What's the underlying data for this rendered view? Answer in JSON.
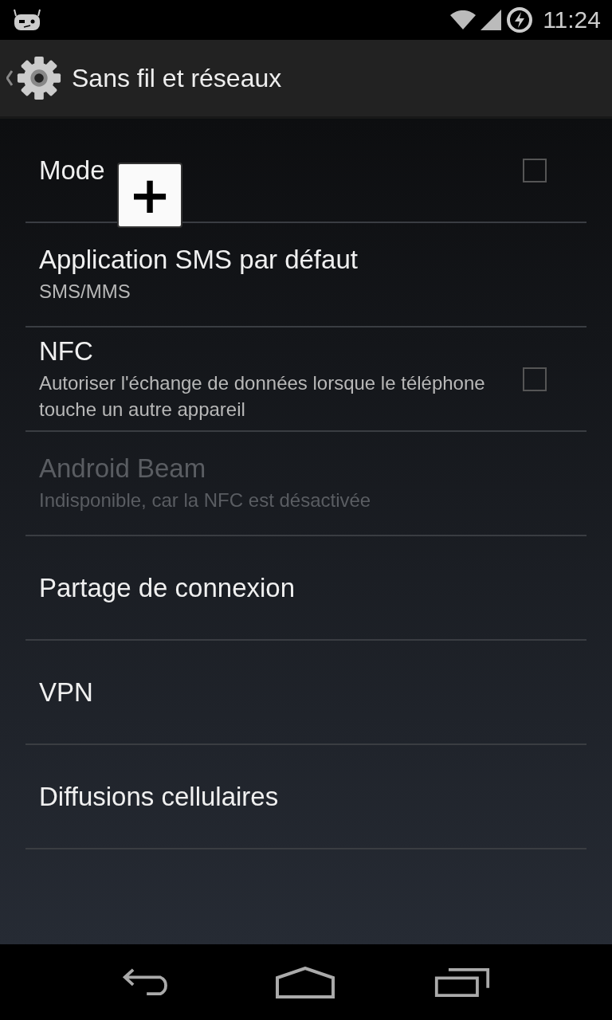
{
  "status_bar": {
    "time": "11:24"
  },
  "action_bar": {
    "title": "Sans fil et réseaux"
  },
  "items": [
    {
      "kind": "checkbox",
      "title": "Mode",
      "checked": false,
      "disabled": false
    },
    {
      "kind": "plain",
      "title": "Application SMS par défaut",
      "summary": "SMS/MMS",
      "disabled": false
    },
    {
      "kind": "checkbox",
      "title": "NFC",
      "summary": "Autoriser l'échange de données lorsque le téléphone touche un autre appareil",
      "checked": false,
      "disabled": false
    },
    {
      "kind": "plain",
      "title": "Android Beam",
      "summary": "Indisponible, car la NFC est désactivée",
      "disabled": true
    },
    {
      "kind": "plain",
      "title": "Partage de connexion",
      "disabled": false
    },
    {
      "kind": "plain",
      "title": "VPN",
      "disabled": false
    },
    {
      "kind": "plain",
      "title": "Diffusions cellulaires",
      "disabled": false
    }
  ],
  "overlay": {
    "label": "+"
  }
}
